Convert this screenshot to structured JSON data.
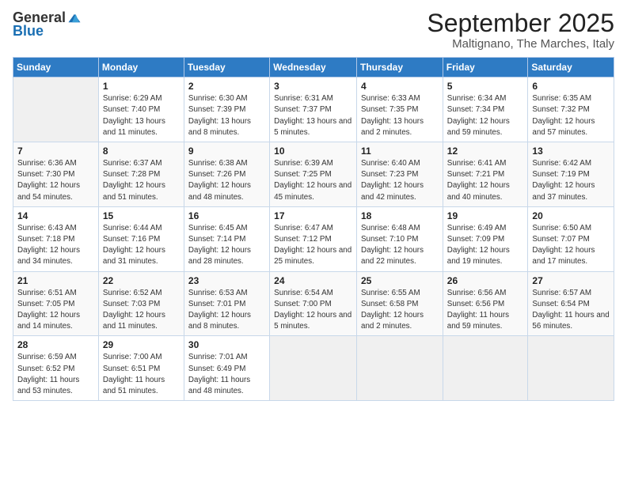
{
  "logo": {
    "general": "General",
    "blue": "Blue"
  },
  "title": "September 2025",
  "subtitle": "Maltignano, The Marches, Italy",
  "days_of_week": [
    "Sunday",
    "Monday",
    "Tuesday",
    "Wednesday",
    "Thursday",
    "Friday",
    "Saturday"
  ],
  "weeks": [
    [
      {
        "day": "",
        "empty": true
      },
      {
        "day": "1",
        "sunrise": "Sunrise: 6:29 AM",
        "sunset": "Sunset: 7:40 PM",
        "daylight": "Daylight: 13 hours and 11 minutes."
      },
      {
        "day": "2",
        "sunrise": "Sunrise: 6:30 AM",
        "sunset": "Sunset: 7:39 PM",
        "daylight": "Daylight: 13 hours and 8 minutes."
      },
      {
        "day": "3",
        "sunrise": "Sunrise: 6:31 AM",
        "sunset": "Sunset: 7:37 PM",
        "daylight": "Daylight: 13 hours and 5 minutes."
      },
      {
        "day": "4",
        "sunrise": "Sunrise: 6:33 AM",
        "sunset": "Sunset: 7:35 PM",
        "daylight": "Daylight: 13 hours and 2 minutes."
      },
      {
        "day": "5",
        "sunrise": "Sunrise: 6:34 AM",
        "sunset": "Sunset: 7:34 PM",
        "daylight": "Daylight: 12 hours and 59 minutes."
      },
      {
        "day": "6",
        "sunrise": "Sunrise: 6:35 AM",
        "sunset": "Sunset: 7:32 PM",
        "daylight": "Daylight: 12 hours and 57 minutes."
      }
    ],
    [
      {
        "day": "7",
        "sunrise": "Sunrise: 6:36 AM",
        "sunset": "Sunset: 7:30 PM",
        "daylight": "Daylight: 12 hours and 54 minutes."
      },
      {
        "day": "8",
        "sunrise": "Sunrise: 6:37 AM",
        "sunset": "Sunset: 7:28 PM",
        "daylight": "Daylight: 12 hours and 51 minutes."
      },
      {
        "day": "9",
        "sunrise": "Sunrise: 6:38 AM",
        "sunset": "Sunset: 7:26 PM",
        "daylight": "Daylight: 12 hours and 48 minutes."
      },
      {
        "day": "10",
        "sunrise": "Sunrise: 6:39 AM",
        "sunset": "Sunset: 7:25 PM",
        "daylight": "Daylight: 12 hours and 45 minutes."
      },
      {
        "day": "11",
        "sunrise": "Sunrise: 6:40 AM",
        "sunset": "Sunset: 7:23 PM",
        "daylight": "Daylight: 12 hours and 42 minutes."
      },
      {
        "day": "12",
        "sunrise": "Sunrise: 6:41 AM",
        "sunset": "Sunset: 7:21 PM",
        "daylight": "Daylight: 12 hours and 40 minutes."
      },
      {
        "day": "13",
        "sunrise": "Sunrise: 6:42 AM",
        "sunset": "Sunset: 7:19 PM",
        "daylight": "Daylight: 12 hours and 37 minutes."
      }
    ],
    [
      {
        "day": "14",
        "sunrise": "Sunrise: 6:43 AM",
        "sunset": "Sunset: 7:18 PM",
        "daylight": "Daylight: 12 hours and 34 minutes."
      },
      {
        "day": "15",
        "sunrise": "Sunrise: 6:44 AM",
        "sunset": "Sunset: 7:16 PM",
        "daylight": "Daylight: 12 hours and 31 minutes."
      },
      {
        "day": "16",
        "sunrise": "Sunrise: 6:45 AM",
        "sunset": "Sunset: 7:14 PM",
        "daylight": "Daylight: 12 hours and 28 minutes."
      },
      {
        "day": "17",
        "sunrise": "Sunrise: 6:47 AM",
        "sunset": "Sunset: 7:12 PM",
        "daylight": "Daylight: 12 hours and 25 minutes."
      },
      {
        "day": "18",
        "sunrise": "Sunrise: 6:48 AM",
        "sunset": "Sunset: 7:10 PM",
        "daylight": "Daylight: 12 hours and 22 minutes."
      },
      {
        "day": "19",
        "sunrise": "Sunrise: 6:49 AM",
        "sunset": "Sunset: 7:09 PM",
        "daylight": "Daylight: 12 hours and 19 minutes."
      },
      {
        "day": "20",
        "sunrise": "Sunrise: 6:50 AM",
        "sunset": "Sunset: 7:07 PM",
        "daylight": "Daylight: 12 hours and 17 minutes."
      }
    ],
    [
      {
        "day": "21",
        "sunrise": "Sunrise: 6:51 AM",
        "sunset": "Sunset: 7:05 PM",
        "daylight": "Daylight: 12 hours and 14 minutes."
      },
      {
        "day": "22",
        "sunrise": "Sunrise: 6:52 AM",
        "sunset": "Sunset: 7:03 PM",
        "daylight": "Daylight: 12 hours and 11 minutes."
      },
      {
        "day": "23",
        "sunrise": "Sunrise: 6:53 AM",
        "sunset": "Sunset: 7:01 PM",
        "daylight": "Daylight: 12 hours and 8 minutes."
      },
      {
        "day": "24",
        "sunrise": "Sunrise: 6:54 AM",
        "sunset": "Sunset: 7:00 PM",
        "daylight": "Daylight: 12 hours and 5 minutes."
      },
      {
        "day": "25",
        "sunrise": "Sunrise: 6:55 AM",
        "sunset": "Sunset: 6:58 PM",
        "daylight": "Daylight: 12 hours and 2 minutes."
      },
      {
        "day": "26",
        "sunrise": "Sunrise: 6:56 AM",
        "sunset": "Sunset: 6:56 PM",
        "daylight": "Daylight: 11 hours and 59 minutes."
      },
      {
        "day": "27",
        "sunrise": "Sunrise: 6:57 AM",
        "sunset": "Sunset: 6:54 PM",
        "daylight": "Daylight: 11 hours and 56 minutes."
      }
    ],
    [
      {
        "day": "28",
        "sunrise": "Sunrise: 6:59 AM",
        "sunset": "Sunset: 6:52 PM",
        "daylight": "Daylight: 11 hours and 53 minutes."
      },
      {
        "day": "29",
        "sunrise": "Sunrise: 7:00 AM",
        "sunset": "Sunset: 6:51 PM",
        "daylight": "Daylight: 11 hours and 51 minutes."
      },
      {
        "day": "30",
        "sunrise": "Sunrise: 7:01 AM",
        "sunset": "Sunset: 6:49 PM",
        "daylight": "Daylight: 11 hours and 48 minutes."
      },
      {
        "day": "",
        "empty": true
      },
      {
        "day": "",
        "empty": true
      },
      {
        "day": "",
        "empty": true
      },
      {
        "day": "",
        "empty": true
      }
    ]
  ]
}
